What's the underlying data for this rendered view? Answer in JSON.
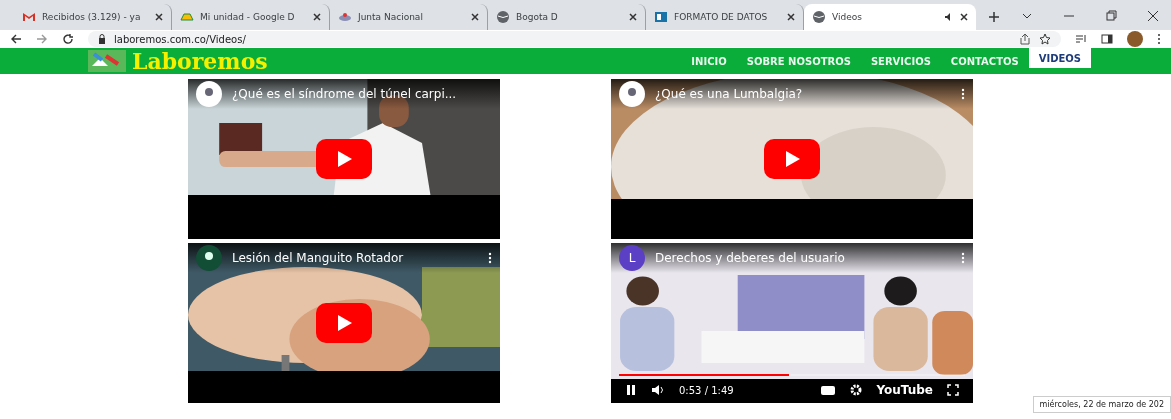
{
  "browser": {
    "tabs": [
      {
        "label": "Recibidos (3.129) - ya",
        "selected": false,
        "audio": false
      },
      {
        "label": "Mi unidad - Google D",
        "selected": false,
        "audio": false
      },
      {
        "label": "Junta Nacional",
        "selected": false,
        "audio": false
      },
      {
        "label": "Bogota D",
        "selected": false,
        "audio": false
      },
      {
        "label": "FORMATO DE DATOS",
        "selected": false,
        "audio": false
      },
      {
        "label": "Videos",
        "selected": true,
        "audio": true
      }
    ],
    "address": "laboremos.com.co/Videos/"
  },
  "site": {
    "logo": "Laboremos",
    "nav": [
      {
        "label": "INICIO",
        "selected": false
      },
      {
        "label": "SOBRE NOSOTROS",
        "selected": false
      },
      {
        "label": "SERVICIOS",
        "selected": false
      },
      {
        "label": "CONTACTOS",
        "selected": false
      },
      {
        "label": "VIDEOS",
        "selected": true
      }
    ]
  },
  "videos": [
    {
      "title": "¿Qué es el síndrome del túnel carpi...",
      "kind": "thumbnail"
    },
    {
      "title": "¿Qué es una Lumbalgia?",
      "kind": "thumbnail"
    },
    {
      "title": "Lesión del Manguito Rotador",
      "kind": "thumbnail"
    },
    {
      "title": "Derechos y deberes del usuario",
      "kind": "playing",
      "channel": "L",
      "time": "0:53 / 1:49",
      "level": 0.49,
      "brand": "YouTube"
    }
  ],
  "tooltip": "miércoles, 22 de marzo de 202"
}
